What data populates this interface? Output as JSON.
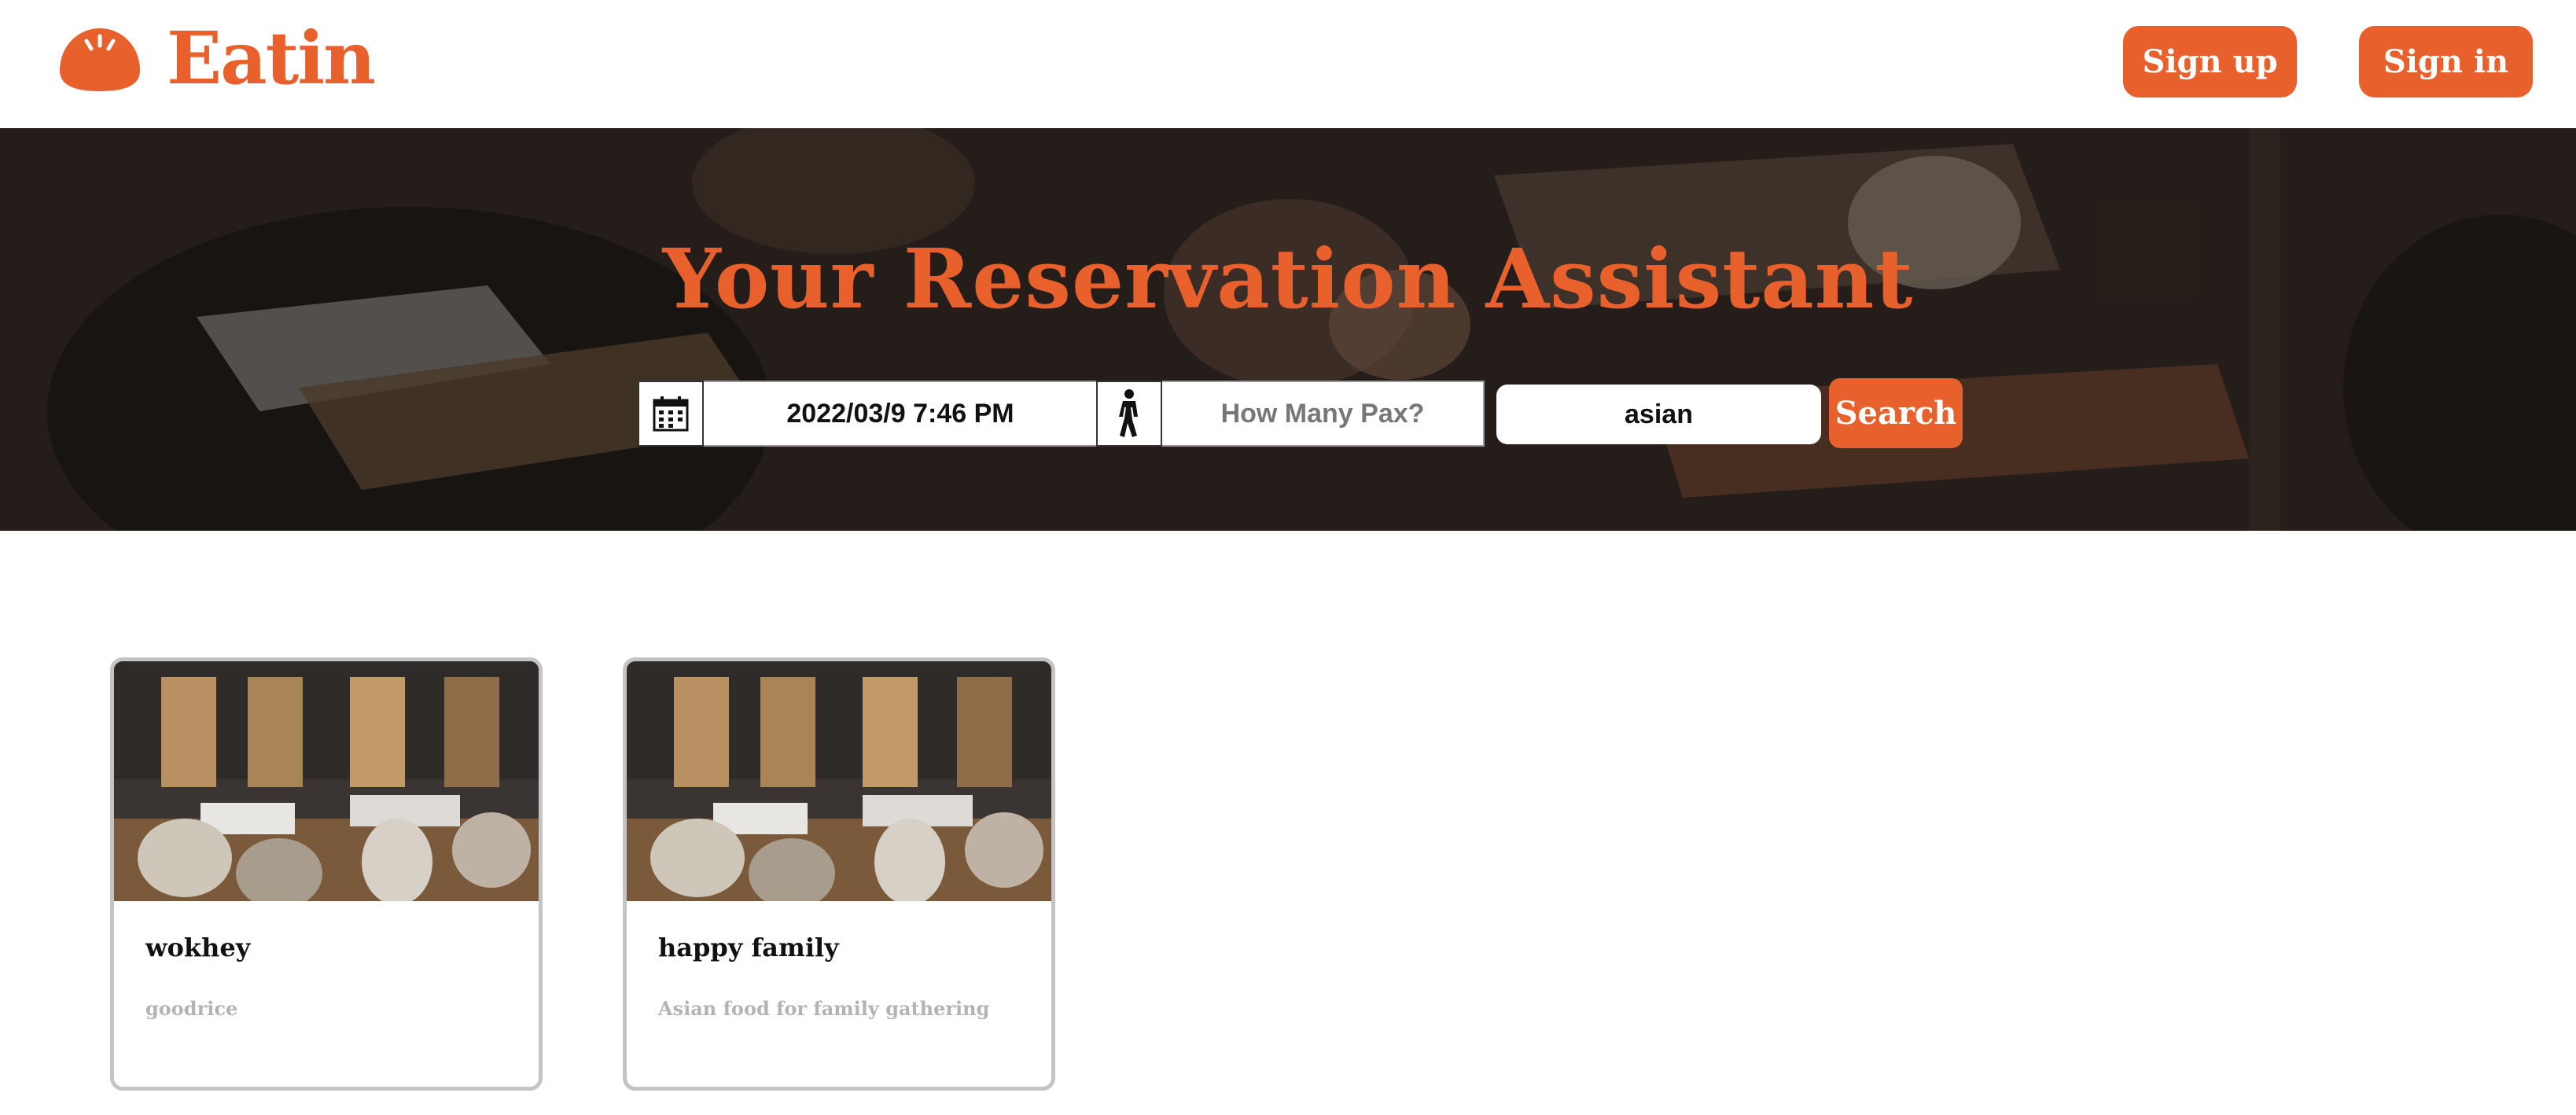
{
  "brand": {
    "name": "Eatin"
  },
  "header": {
    "signup_label": "Sign up",
    "signin_label": "Sign in"
  },
  "hero": {
    "title": "Your Reservation Assistant",
    "date_value": "2022/03/9 7:46 PM",
    "pax_placeholder": "How Many Pax?",
    "search_value": "asian",
    "search_label": "Search"
  },
  "restaurants": [
    {
      "name": "wokhey",
      "description": "goodrice"
    },
    {
      "name": "happy family",
      "description": "Asian food for family gathering"
    }
  ],
  "colors": {
    "accent": "#e8602c",
    "card_border": "#c4c4c4",
    "muted_text": "#b3b3b3"
  },
  "icons": {
    "logo": "bun-icon",
    "date": "calendar-icon",
    "pax": "walking-person-icon"
  }
}
